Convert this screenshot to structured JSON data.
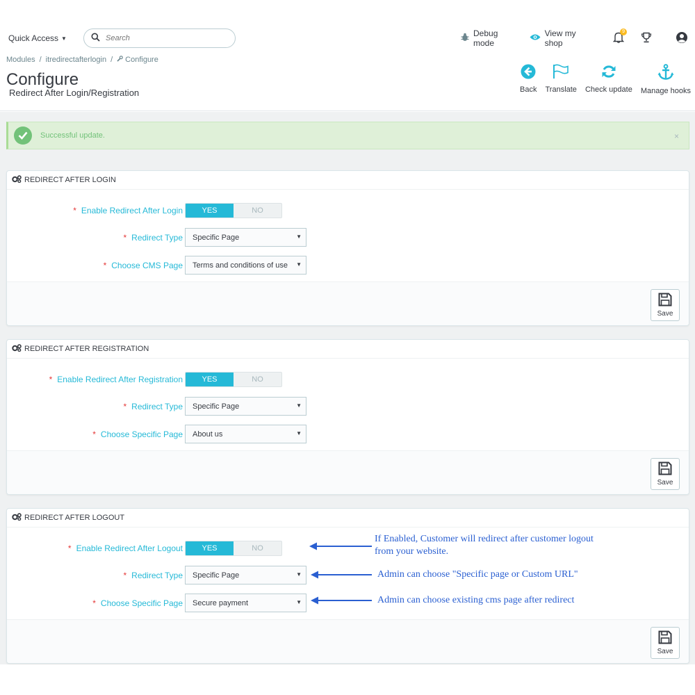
{
  "topbar": {
    "quick_access": "Quick Access",
    "search_placeholder": "Search",
    "debug_mode": "Debug mode",
    "view_shop": "View my shop",
    "notif_count": "9"
  },
  "breadcrumb": {
    "items": [
      "Modules",
      "/",
      "itredirectafterlogin",
      "/",
      "Configure"
    ]
  },
  "page": {
    "title": "Configure",
    "subtitle": "Redirect After Login/Registration"
  },
  "toolbar": {
    "back": "Back",
    "translate": "Translate",
    "check_update": "Check update",
    "manage_hooks": "Manage hooks"
  },
  "alert": {
    "text": "Successful update.",
    "close": "×"
  },
  "panels": [
    {
      "title": "REDIRECT AFTER LOGIN",
      "fields": [
        {
          "label": "Enable Redirect After Login",
          "type": "toggle",
          "yes": "YES",
          "no": "NO",
          "value": "YES"
        },
        {
          "label": "Redirect Type",
          "type": "select",
          "value": "Specific Page"
        },
        {
          "label": "Choose CMS Page",
          "type": "select",
          "value": "Terms and conditions of use"
        }
      ],
      "save": "Save"
    },
    {
      "title": "REDIRECT AFTER REGISTRATION",
      "fields": [
        {
          "label": "Enable Redirect After Registration",
          "type": "toggle",
          "yes": "YES",
          "no": "NO",
          "value": "YES"
        },
        {
          "label": "Redirect Type",
          "type": "select",
          "value": "Specific Page"
        },
        {
          "label": "Choose Specific Page",
          "type": "select",
          "value": "About us"
        }
      ],
      "save": "Save"
    },
    {
      "title": "REDIRECT AFTER LOGOUT",
      "fields": [
        {
          "label": "Enable Redirect After Logout",
          "type": "toggle",
          "yes": "YES",
          "no": "NO",
          "value": "YES"
        },
        {
          "label": "Redirect Type",
          "type": "select",
          "value": "Specific Page"
        },
        {
          "label": "Choose Specific Page",
          "type": "select",
          "value": "Secure payment"
        }
      ],
      "save": "Save"
    }
  ],
  "annotations": {
    "logout_enable_line1": "If Enabled, Customer will redirect after customer logout",
    "logout_enable_line2": "from your website.",
    "redirect_type": "Admin can choose \"Specific page or Custom URL\"",
    "specific_page": "Admin can choose existing cms page after redirect"
  },
  "colors": {
    "primary": "#25b9d7",
    "success": "#72c279",
    "required": "#e43737",
    "annotation": "#2a5fd1"
  }
}
